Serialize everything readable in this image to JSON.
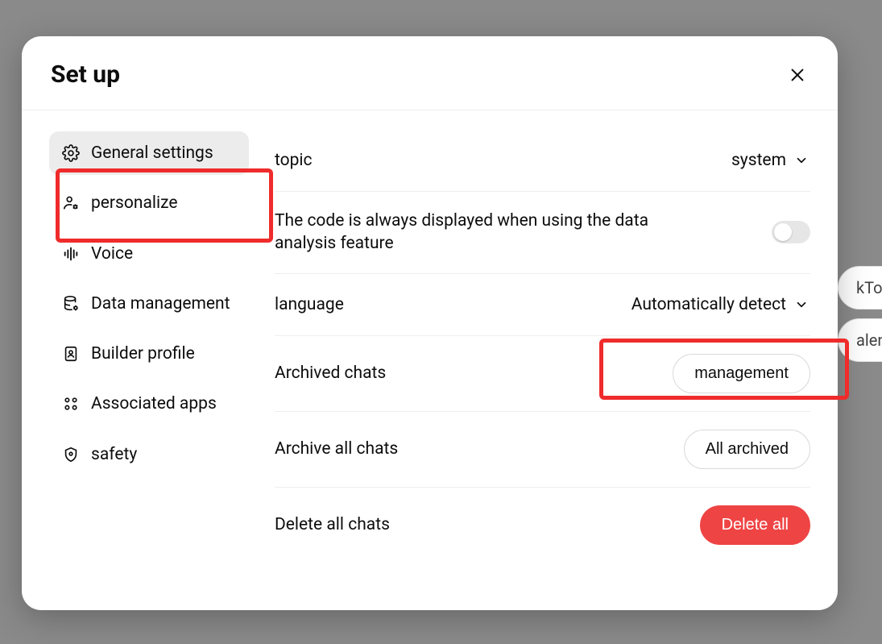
{
  "modal": {
    "title": "Set up"
  },
  "sidebar": {
    "items": [
      {
        "label": "General settings"
      },
      {
        "label": "personalize"
      },
      {
        "label": "Voice"
      },
      {
        "label": "Data management"
      },
      {
        "label": "Builder profile"
      },
      {
        "label": "Associated apps"
      },
      {
        "label": "safety"
      }
    ]
  },
  "settings": {
    "topic": {
      "label": "topic",
      "value": "system"
    },
    "code_toggle": {
      "label": "The code is always displayed when using the data analysis feature",
      "on": false
    },
    "language": {
      "label": "language",
      "value": "Automatically detect"
    },
    "archived": {
      "label": "Archived chats",
      "button": "management"
    },
    "archive_all": {
      "label": "Archive all chats",
      "button": "All archived"
    },
    "delete_all": {
      "label": "Delete all chats",
      "button": "Delete all"
    }
  },
  "background": {
    "chip1": "kTok",
    "chip2": "alend"
  }
}
